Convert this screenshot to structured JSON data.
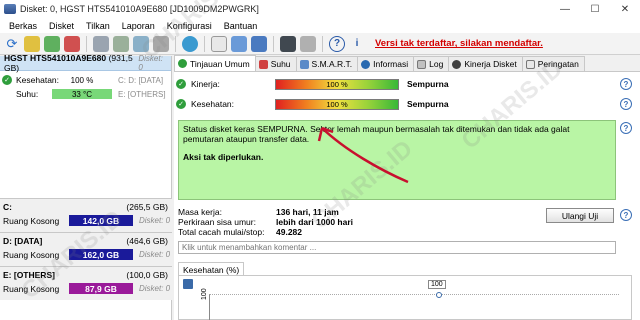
{
  "window": {
    "title": "Disket: 0, HGST HTS541010A9E680 [JD1009DM2PWGRK]",
    "minimize_icon": "minimize-icon",
    "maximize_icon": "maximize-icon",
    "close_icon": "close-icon"
  },
  "menu": [
    "Berkas",
    "Disket",
    "Tilkan",
    "Laporan",
    "Konfigurasi",
    "Bantuan"
  ],
  "toolbar": {
    "promo_text": "Versi tak terdaftar, silakan mendaftar."
  },
  "disk": {
    "name": "HGST HTS541010A9E680",
    "size": "(931,5 GB)",
    "kind": "Disket: 0",
    "health_label": "Kesehatan:",
    "health_value": "100 %",
    "temp_label": "Suhu:",
    "temp_value": "33 °C",
    "partitions_line1": "C: D: [DATA]",
    "partitions_line2": "E: [OTHERS]"
  },
  "partitions": [
    {
      "name": "C:",
      "size": "(265,5 GB)",
      "free_label": "Ruang Kosong",
      "free": "142,0 GB",
      "disk": "Disket: 0",
      "color": "#1a1a9a"
    },
    {
      "name": "D: [DATA]",
      "size": "(464,6 GB)",
      "free_label": "Ruang Kosong",
      "free": "162,0 GB",
      "disk": "Disket: 0",
      "color": "#1a1a9a"
    },
    {
      "name": "E: [OTHERS]",
      "size": "(100,0 GB)",
      "free_label": "Ruang Kosong",
      "free": "87,9 GB",
      "disk": "Disket: 0",
      "color": "#9a1a9a"
    }
  ],
  "tabs": [
    "Tinjauan Umum",
    "Suhu",
    "S.M.A.R.T.",
    "Informasi",
    "Log",
    "Kinerja Disket",
    "Peringatan"
  ],
  "overview": {
    "performance_label": "Kinerja:",
    "performance_value": "100 %",
    "performance_verdict": "Sempurna",
    "health_label": "Kesehatan:",
    "health_value": "100 %",
    "health_verdict": "Sempurna",
    "summary": "Status disket keras SEMPURNA. Sektor lemah maupun bermasalah tak ditemukan dan tidak ada galat pemutaran ataupun transfer data.",
    "action": "Aksi tak diperlukan.",
    "power_on_label": "Masa kerja:",
    "power_on_value": "136 hari, 11 jam",
    "remaining_label": "Perkiraan sisa umur:",
    "remaining_value": "lebih dari 1000 hari",
    "starts_label": "Total cacah mulai/stop:",
    "starts_value": "49.282",
    "retest_button": "Ulangi Uji",
    "comment_placeholder": "Klik untuk menambahkan komentar ...",
    "graph_tab": "Kesehatan (%)",
    "graph_ytick": "100",
    "graph_point_label": "100"
  },
  "watermark": "CHARIS.ID",
  "colors": {
    "health_green": "#78d878",
    "summary_bg": "#b9f5a5",
    "promo_red": "#d40000",
    "arrow_red": "#c8102e"
  }
}
